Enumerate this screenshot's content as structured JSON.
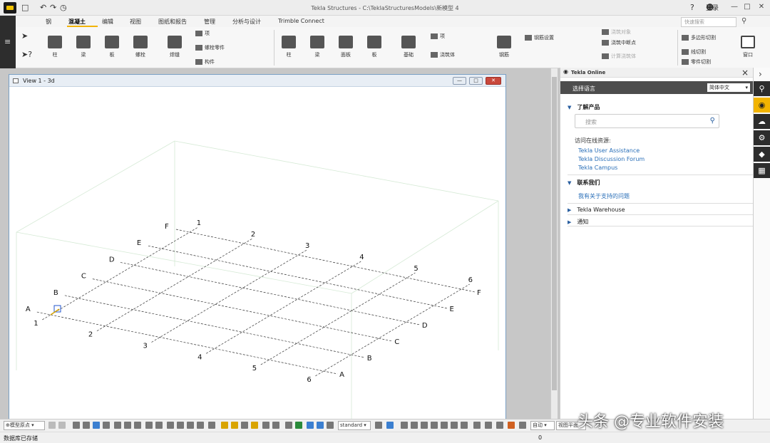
{
  "titlebar": {
    "title": "Tekla Structures - C:\\TeklaStructuresModels\\新模型 4",
    "user_label": "登录",
    "undo_icon": "undo-icon",
    "redo_icon": "redo-icon"
  },
  "tabs": [
    "钢",
    "混凝土",
    "编辑",
    "视图",
    "图纸和报告",
    "管理",
    "分析与设计",
    "Trimble Connect"
  ],
  "active_tab": "混凝土",
  "quick_search": {
    "placeholder": "快速搜索"
  },
  "ribbon": {
    "group1": [
      {
        "label": "柱"
      },
      {
        "label": "梁"
      },
      {
        "label": "板"
      },
      {
        "label": "螺栓"
      },
      {
        "label": "焊缝"
      }
    ],
    "group1_small": [
      "项",
      "螺栓零件",
      "构件"
    ],
    "group2": [
      {
        "label": "柱"
      },
      {
        "label": "梁"
      },
      {
        "label": "面板"
      },
      {
        "label": "板"
      },
      {
        "label": "基础"
      }
    ],
    "group2_small": [
      "项",
      "浇筑体"
    ],
    "rebar_label": "钢筋",
    "rebar_settings": "钢筋设置",
    "pour_items": [
      "浇筑对象",
      "浇筑中断点",
      "计算浇筑体"
    ],
    "cut_items": [
      "多边形切割",
      "线切割",
      "零件切割"
    ],
    "window_label": "窗口"
  },
  "view": {
    "title": "View 1 - 3d",
    "grid_rows": [
      "A",
      "B",
      "C",
      "D",
      "E",
      "F"
    ],
    "grid_cols": [
      "1",
      "2",
      "3",
      "4",
      "5",
      "6"
    ]
  },
  "panel": {
    "header": "Tekla Online",
    "language_label": "选择语言",
    "language_value": "简体中文",
    "learn_title": "了解产品",
    "search_placeholder": "搜索",
    "visit_label": "访问在线资源:",
    "links": [
      "Tekla User Assistance",
      "Tekla Discussion Forum",
      "Tekla Campus"
    ],
    "contact_title": "联系我们",
    "contact_link": "我有关于支持的问题",
    "warehouse_title": "Tekla Warehouse",
    "notice_title": "通知"
  },
  "bottombar": {
    "origin": "模型原点",
    "standard": "standard",
    "auto": "自动",
    "view_plane": "视图平面"
  },
  "status": {
    "message": "数据库已存储",
    "count": "0"
  },
  "watermark": "头条 @专业软件安装"
}
